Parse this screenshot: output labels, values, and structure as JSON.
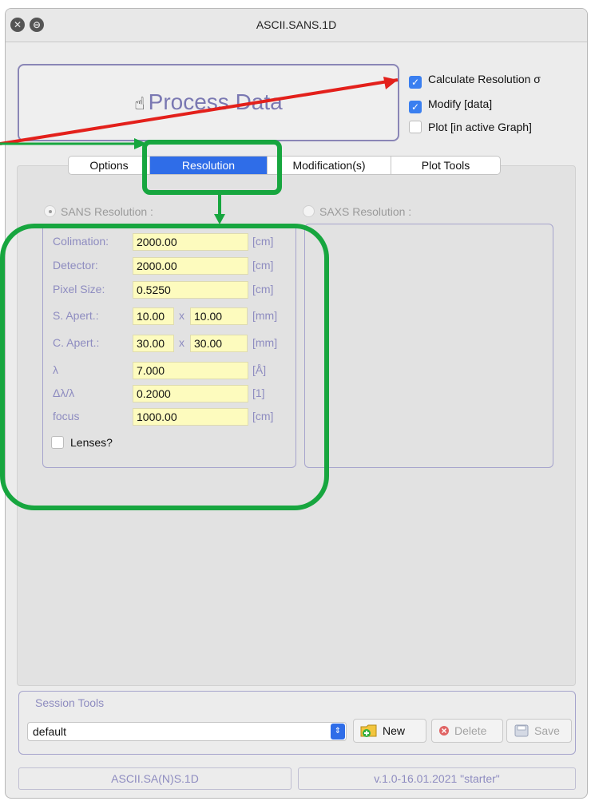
{
  "window": {
    "title": "ASCII.SANS.1D",
    "close_glyph": "✕",
    "minimize_glyph": "⊖"
  },
  "process": {
    "label": "Process Data",
    "hand_icon": "hand-pointer-icon",
    "hand_glyph": "☝"
  },
  "options": [
    {
      "label": "Calculate Resolution σ",
      "checked": true
    },
    {
      "label": "Modify [data]",
      "checked": true
    },
    {
      "label": "Plot [in active Graph]",
      "checked": false
    }
  ],
  "checkmark": "✓",
  "tabs": [
    {
      "label": "Options",
      "active": false
    },
    {
      "label": "Resolution",
      "active": true
    },
    {
      "label": "Modification(s)",
      "active": false
    },
    {
      "label": "Plot Tools",
      "active": false
    }
  ],
  "sans": {
    "title": "SANS Resolution :",
    "fields": {
      "colimation": {
        "label": "Colimation:",
        "value": "2000.00",
        "unit": "[cm]"
      },
      "detector": {
        "label": "Detector:",
        "value": "2000.00",
        "unit": "[cm]"
      },
      "pixel": {
        "label": "Pixel Size:",
        "value": "0.5250",
        "unit": "[cm]"
      },
      "s_apert": {
        "label": "S. Apert.:",
        "value1": "10.00",
        "x": "x",
        "value2": "10.00",
        "unit": "[mm]"
      },
      "c_apert": {
        "label": "C. Apert.:",
        "value1": "30.00",
        "x": "x",
        "value2": "30.00",
        "unit": "[mm]"
      },
      "lambda": {
        "label": "λ",
        "value": "7.000",
        "unit": "[Å]"
      },
      "dlambda": {
        "label": "Δλ/λ",
        "value": "0.2000",
        "unit": "[1]"
      },
      "focus": {
        "label": "focus",
        "value": "1000.00",
        "unit": "[cm]"
      }
    },
    "lenses_label": "Lenses?"
  },
  "saxs": {
    "title": "SAXS Resolution :"
  },
  "session": {
    "title": "Session Tools",
    "selected": "default",
    "combo_arrow": "⇕",
    "new_label": "New",
    "delete_label": "Delete",
    "save_label": "Save"
  },
  "status": {
    "left": "ASCII.SA(N)S.1D",
    "right": "v.1.0-16.01.2021 \"starter\""
  },
  "annotation_colors": {
    "arrow_red": "#e3201b",
    "highlight_green": "#17a63f"
  }
}
